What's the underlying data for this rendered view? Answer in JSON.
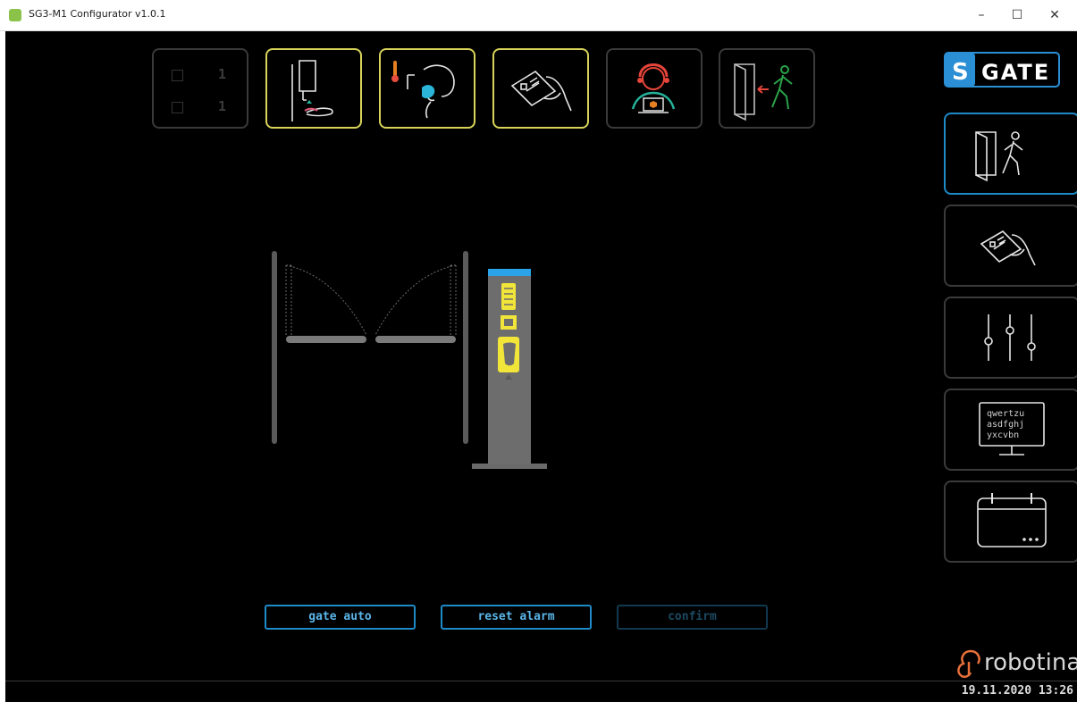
{
  "window": {
    "title": "SG3-M1 Configurator v1.0.1",
    "minimize": "–",
    "maximize": "☐",
    "close": "✕"
  },
  "counters": [
    {
      "value": "1"
    },
    {
      "value": "1"
    }
  ],
  "top_tiles": [
    {
      "icon": "hand-sanitizer-icon",
      "state": "active"
    },
    {
      "icon": "thermometer-face-icon",
      "state": "active"
    },
    {
      "icon": "card-hand-icon",
      "state": "active"
    },
    {
      "icon": "operator-headset-icon",
      "state": "inactive"
    },
    {
      "icon": "door-exit-person-icon",
      "state": "inactive"
    }
  ],
  "brand": {
    "s_letter": "S",
    "gate": "GATE"
  },
  "side_menu": [
    {
      "icon": "door-person-icon",
      "state": "selected"
    },
    {
      "icon": "card-hand-icon",
      "state": "normal"
    },
    {
      "icon": "sliders-icon",
      "state": "normal"
    },
    {
      "icon": "keyboard-monitor-icon",
      "state": "normal",
      "lines": [
        "qwertzu",
        "asdfghj",
        "yxcvbn"
      ]
    },
    {
      "icon": "calendar-icon",
      "state": "normal"
    }
  ],
  "buttons": {
    "gate_auto": "gate auto",
    "reset_alarm": "reset alarm",
    "confirm": "confirm"
  },
  "footer": {
    "logo": "robotina",
    "datetime": "19.11.2020 13:26"
  },
  "colors": {
    "active_yellow": "#d8d35a",
    "accent_blue": "#1e8ac7",
    "inactive_gray": "#3a3a3a",
    "robotina_orange": "#e8703a"
  }
}
